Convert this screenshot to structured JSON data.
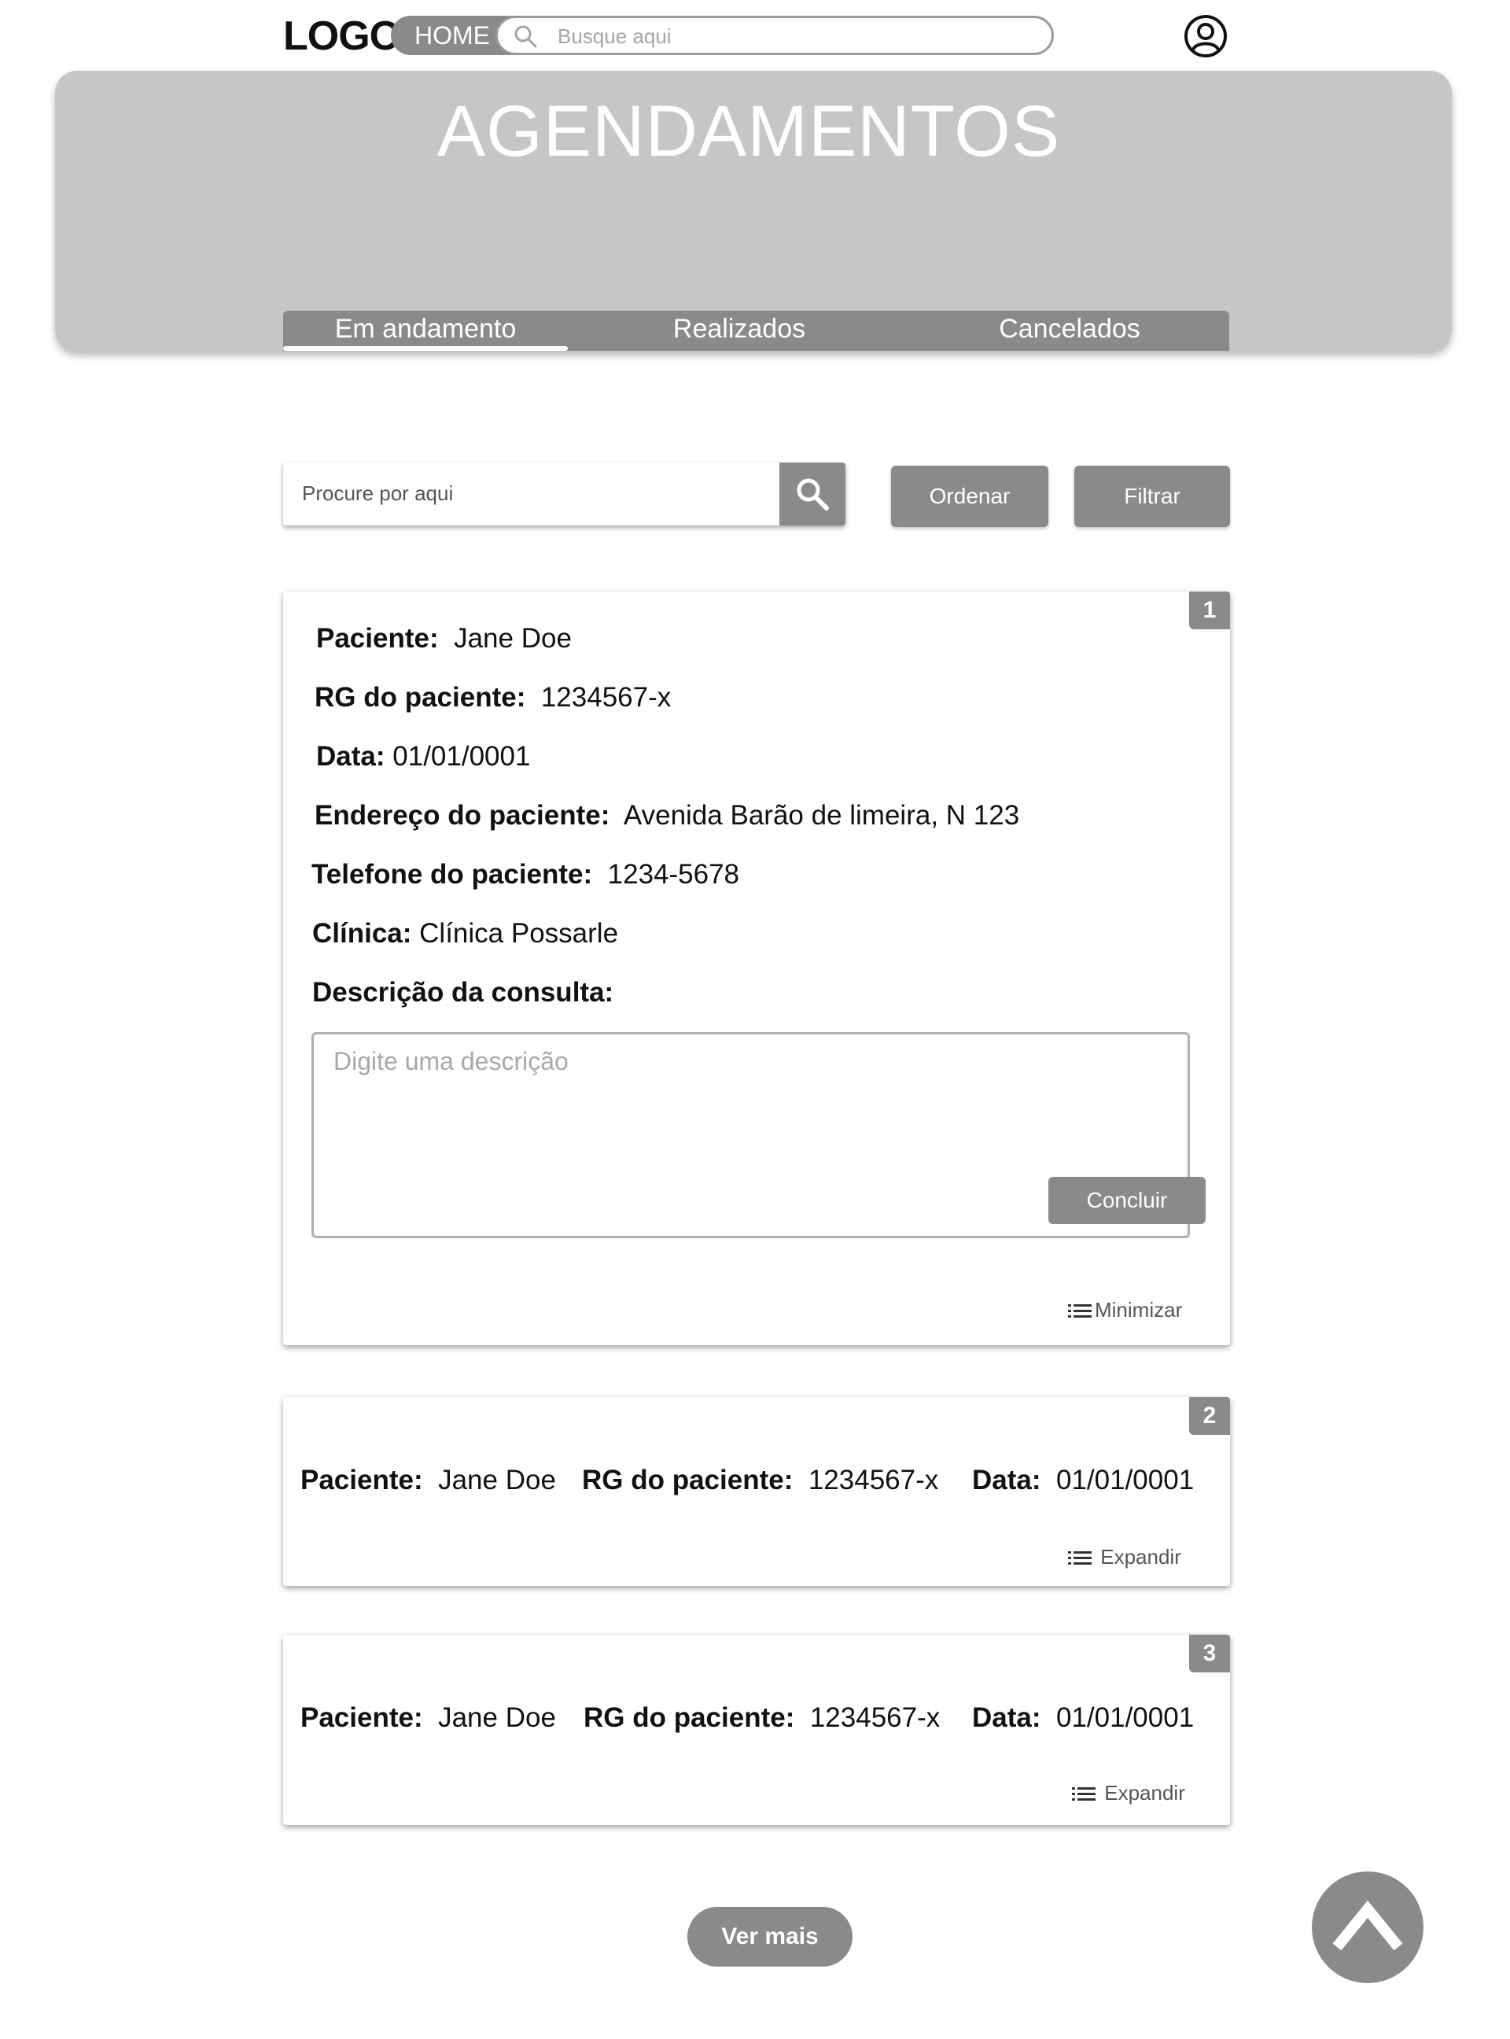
{
  "nav": {
    "logo": "LOGO",
    "home": "HOME",
    "search_placeholder": "Busque aqui"
  },
  "hero": {
    "title": "AGENDAMENTOS",
    "tabs": [
      "Em andamento",
      "Realizados",
      "Cancelados"
    ],
    "active_tab": "Em andamento"
  },
  "controls": {
    "search_placeholder": "Procure por aqui",
    "order": "Ordenar",
    "filter": "Filtrar"
  },
  "cards": [
    {
      "number": "1",
      "expanded": true,
      "patient_label": "Paciente:",
      "patient": "Jane Doe",
      "rg_label": "RG do paciente:",
      "rg": "1234567-x",
      "date_label": "Data:",
      "date": "01/01/0001",
      "address_label": "Endereço do paciente:",
      "address": "Avenida Barão de limeira, N 123",
      "phone_label": "Telefone do paciente:",
      "phone": "1234-5678",
      "clinic_label": "Clínica:",
      "clinic": "Clínica Possarle",
      "description_label": "Descrição da consulta:",
      "description_placeholder": "Digite uma descrição",
      "conclude": "Concluir",
      "toggle": "Minimizar"
    },
    {
      "number": "2",
      "expanded": false,
      "patient_label": "Paciente:",
      "patient": "Jane Doe",
      "rg_label": "RG do paciente:",
      "rg": "1234567-x",
      "date_label": "Data:",
      "date": "01/01/0001",
      "toggle": "Expandir"
    },
    {
      "number": "3",
      "expanded": false,
      "patient_label": "Paciente:",
      "patient": "Jane Doe",
      "rg_label": "RG do paciente:",
      "rg": "1234567-x",
      "date_label": "Data:",
      "date": "01/01/0001",
      "toggle": "Expandir"
    }
  ],
  "footer": {
    "more": "Ver mais",
    "back_to_top_icon": "chevron-up-icon"
  }
}
